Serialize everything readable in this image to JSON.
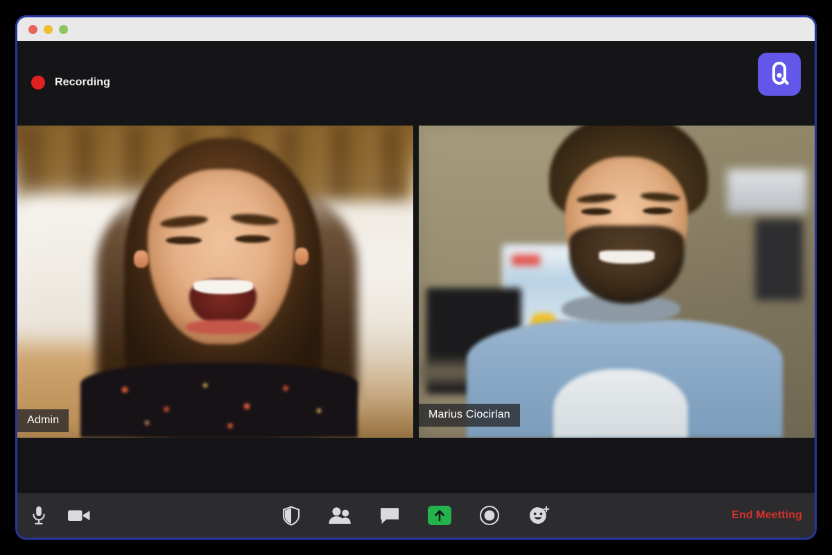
{
  "window": {
    "traffic_lights": [
      {
        "name": "close",
        "color": "#e8645c"
      },
      {
        "name": "minimize",
        "color": "#efbe2c"
      },
      {
        "name": "maximize",
        "color": "#8fc362"
      }
    ],
    "border_color": "#26389b",
    "background": "#151518"
  },
  "header": {
    "recording_label": "Recording",
    "recording_dot_color": "#e32020",
    "logo_letter": "Q",
    "logo_background": "#6257e8",
    "logo_name": "quickmeet-logo"
  },
  "video_grid": {
    "tiles": [
      {
        "name_badge": "Admin",
        "tile_name": "video-tile-admin",
        "scene": "blurred living room with bookshelf"
      },
      {
        "name_badge": "Marius Ciocirlan",
        "tile_name": "video-tile-marius",
        "scene": "blurred office with monitors"
      }
    ]
  },
  "toolbar": {
    "background": "#2c2c2e",
    "left_controls": [
      {
        "icon": "microphone-icon",
        "label": "Mute"
      },
      {
        "icon": "video-camera-icon",
        "label": "Stop Video"
      }
    ],
    "center_controls": [
      {
        "icon": "shield-icon",
        "label": "Security"
      },
      {
        "icon": "participants-icon",
        "label": "Participants"
      },
      {
        "icon": "chat-bubble-icon",
        "label": "Chat"
      },
      {
        "icon": "share-screen-icon",
        "label": "Share Screen",
        "accent": "#24b24c"
      },
      {
        "icon": "record-icon",
        "label": "Record"
      },
      {
        "icon": "reactions-icon",
        "label": "Reactions"
      }
    ],
    "end_meeting_label": "End Meetting",
    "end_meeting_color": "#d6322c"
  }
}
